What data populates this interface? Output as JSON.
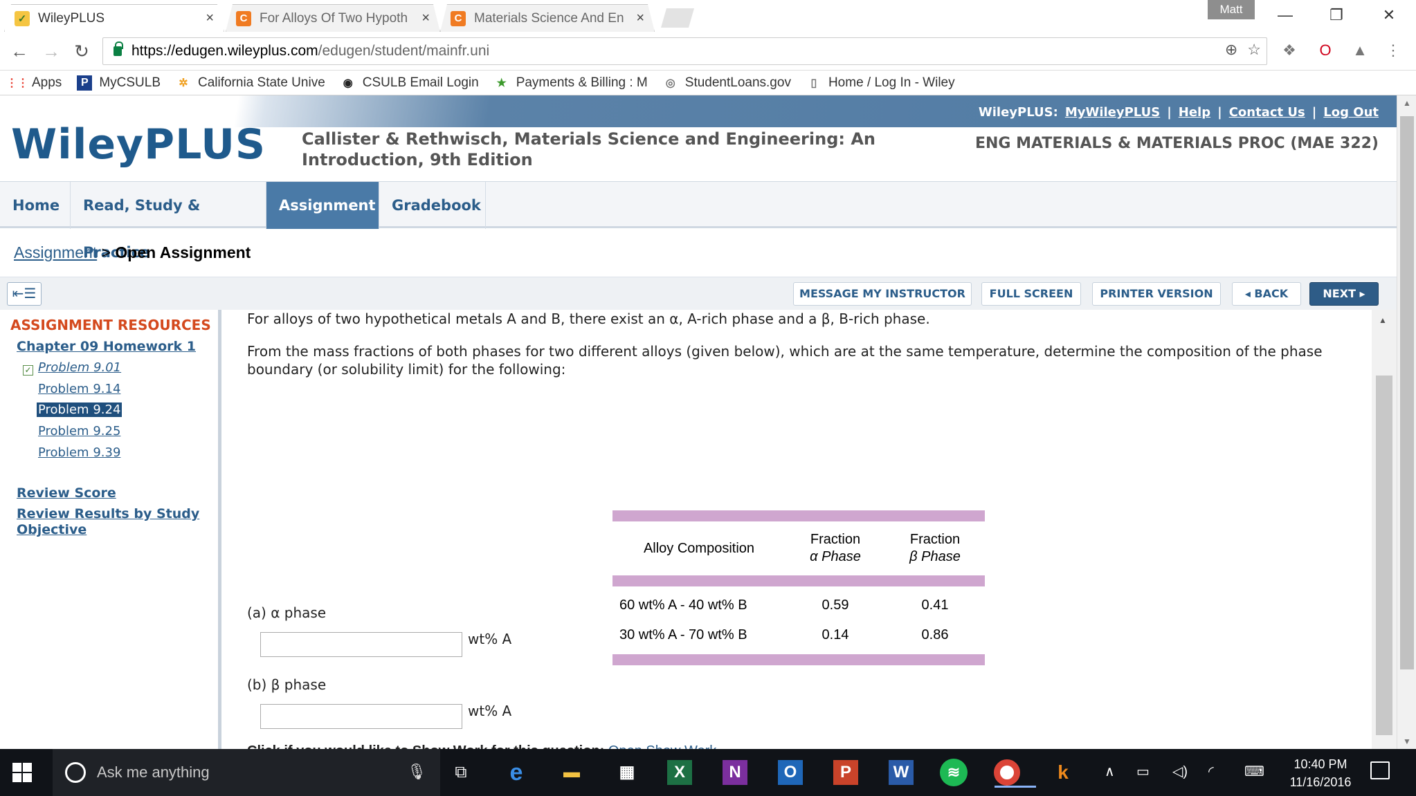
{
  "browser": {
    "tabs": [
      {
        "title": "WileyPLUS",
        "close": "×"
      },
      {
        "title": "For Alloys Of Two Hypoth",
        "close": "×"
      },
      {
        "title": "Materials Science And En",
        "close": "×"
      }
    ],
    "profile": "Matt",
    "url_domain": "https://edugen.wileyplus.com",
    "url_path": "/edugen/student/mainfr.uni",
    "bookmarks": [
      "Apps",
      "MyCSULB",
      "California State Unive",
      "CSULB Email Login",
      "Payments & Billing : M",
      "StudentLoans.gov",
      "Home / Log In - Wiley"
    ]
  },
  "header": {
    "toplinks_prefix": "WileyPLUS:",
    "toplinks": [
      "MyWileyPLUS",
      "Help",
      "Contact Us",
      "Log Out"
    ],
    "separator": "|",
    "logo": "WileyPLUS",
    "book_title": "Callister & Rethwisch, Materials Science and Engineering: An Introduction, 9th Edition",
    "course": "ENG MATERIALS & MATERIALS PROC (MAE 322)"
  },
  "nav": {
    "tabs": [
      "Home",
      "Read, Study & Practice",
      "Assignment",
      "Gradebook"
    ],
    "active": "Assignment"
  },
  "breadcrumb": {
    "link": "Assignment",
    "sep": ">",
    "current": "Open Assignment"
  },
  "actions": {
    "message": "MESSAGE MY INSTRUCTOR",
    "fullscreen": "FULL SCREEN",
    "printer": "PRINTER VERSION",
    "back": "◂ BACK",
    "next": "NEXT ▸"
  },
  "sidebar": {
    "heading": "ASSIGNMENT RESOURCES",
    "chapter": "Chapter 09 Homework 1",
    "problems": [
      "Problem 9.01",
      "Problem 9.14",
      "Problem 9.24",
      "Problem 9.25",
      "Problem 9.39"
    ],
    "selected": "Problem 9.24",
    "review_score": "Review Score",
    "review_results": "Review Results by Study Objective"
  },
  "question": {
    "intro": "For alloys of two hypothetical metals A and B, there exist an α, A-rich phase and a β, B-rich phase.",
    "prompt": "From the mass fractions of both phases for two different alloys (given below), which are at the same temperature, determine the composition of the phase boundary (or solubility limit) for the following:",
    "table": {
      "headers": [
        "Alloy Composition",
        "Fraction α Phase",
        "Fraction β Phase"
      ],
      "header_lines": [
        [
          "Alloy Composition"
        ],
        [
          "Fraction",
          "α Phase"
        ],
        [
          "Fraction",
          "β Phase"
        ]
      ],
      "rows": [
        [
          "60 wt% A - 40 wt% B",
          "0.59",
          "0.41"
        ],
        [
          "30 wt% A - 70 wt% B",
          "0.14",
          "0.86"
        ]
      ]
    },
    "part_a": "(a) α phase",
    "part_b": "(b) β phase",
    "unit": "wt% A",
    "show_work": "Click if you would like to Show Work for this question:",
    "show_work_link": "Open Show Work"
  },
  "taskbar": {
    "search_placeholder": "Ask me anything",
    "time": "10:40 PM",
    "date": "11/16/2016"
  },
  "colors": {
    "wiley_blue": "#1f5a8c",
    "nav_active": "#4a7aa7",
    "resources_heading": "#d4491e",
    "table_band": "#cfa6cf"
  }
}
